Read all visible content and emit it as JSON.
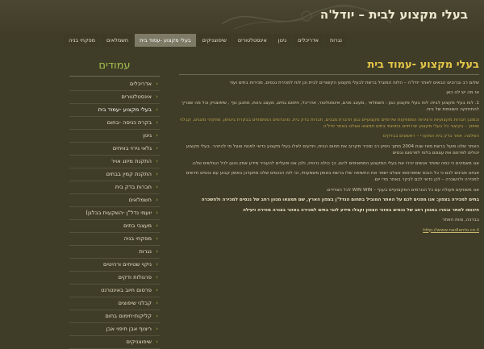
{
  "header": {
    "site_title": "בעלי מקצוע לבית – יודל'ה"
  },
  "nav": {
    "items": [
      {
        "label": "נגרות",
        "active": false
      },
      {
        "label": "אדריכלים",
        "active": false
      },
      {
        "label": "גינון",
        "active": false
      },
      {
        "label": "אינסטלטורים",
        "active": false
      },
      {
        "label": "שיפוצניקים",
        "active": false
      },
      {
        "label": "בעלי מקצוע -עמוד בית",
        "active": true
      },
      {
        "label": "חשמלאים",
        "active": false
      },
      {
        "label": "מפקחי בניה",
        "active": false
      }
    ]
  },
  "sidebar": {
    "title": "עמודים",
    "items": [
      {
        "label": "אדריכלים"
      },
      {
        "label": "אינסטלטורים"
      },
      {
        "label": "בעלי מקצוע -עמוד בית",
        "current": true
      },
      {
        "label": "בקרת כניסה -בחום"
      },
      {
        "label": "גינון"
      },
      {
        "label": "גלאי גירוי בוויחים"
      },
      {
        "label": "התקנת מיזוג אויר"
      },
      {
        "label": "התקנת קמין בבתים"
      },
      {
        "label": "חברות בדק בית"
      },
      {
        "label": "חשמלאים"
      },
      {
        "label": "יועמי נדל\"ן -השקעות בבלגן)"
      },
      {
        "label": "מעצבי בתים"
      },
      {
        "label": "מפקחי בניה"
      },
      {
        "label": "נגרות"
      },
      {
        "label": "ניקוי שטיחים ורהיטים"
      },
      {
        "label": "פרגולות ודקים"
      },
      {
        "label": "פרסום חיוב באינטרנט"
      },
      {
        "label": "קבלני שיפוצים"
      },
      {
        "label": "קליקות-חימום בחום"
      },
      {
        "label": "ריצוף אבן חיפוי אבן"
      },
      {
        "label": "שיפוצניקים"
      }
    ]
  },
  "content": {
    "title": "בעלי מקצוע -עמוד בית",
    "paragraphs": [
      {
        "text": "שלום רב וברוכים הבאים לאתר יודל'ה – הלוח המוביל ברשת לבעלי מקצוע הקשורים לבית וכן לוח למכירת נכסים, מכירות בתים ועוד",
        "style": "normal"
      },
      {
        "text": "אז מה יש לנו כאן",
        "style": "normal"
      },
      {
        "text": "1. לוח בעלי מקצוע לבית: לוח בעלי מקצוע כגון : חשמלאי , מעצב פנים, אינסטלטור, אדריכל, חימום בתים, מעצב גינות, מתכנן נוף , שיפוצניק וכל מה שצריך להתחזקה השוטפת של בית.",
        "style": "normal"
      },
      {
        "text": "וכמובן חברות מקצועיות ורציניות המספקות שירותים מקצועיים כגון הדברת מבנים, חברות בדק בית, מהנדסים המתמחים בבקרת ביטחון, מתקיני מזגנים, קבלני שיפוץ – בקיצור כל בעלי מקצוע יצירתיים בתחומי בתים תמצאו אצלנו באתר יודל'ה",
        "style": "accent"
      },
      {
        "text": "המלצה: אתר בדק בית המקורי – ראשונים בבדקים",
        "style": "accent"
      },
      {
        "text": "האתר שלנו פועל ברשת מאז שנת 2004 מתוך ניסיון רב ומכיר מקרוב את תחום הבית, ויודעים לאלו בעלי מקצוע כדאי לפנות ואצל מי להיזהר. בעלי מקצוע יכולים לפרסם את עצמם בלוח לפרסום נכסים",
        "style": "normal"
      },
      {
        "text": "אנו מאמינים כי כמה שיותר אנשים יכירו את בעלי המקצוע המתאימים להם, כך כולנו נרוויח, ולכן אנו פועלים להעביר מידע אמין והוגן לכל הגולשים שלנו.",
        "style": "normal"
      },
      {
        "text": "אנחנו מבינים לכם כי כל הנכס שתפרסמו אצלנו ישפר את החשיפה שלו ברשת באופן משמעותי, וכי לוח הנכסים שלנו מתעדכן באופן קבוע עם נכסים חדשים למכירה ולהשכרה – לכן כדאי לכם לבקר באתר מדי יום.",
        "style": "normal"
      },
      {
        "text": "אנו משווקים פעולה עם כל הגורמים המקצועיים בענף – WIN WIN לכל הצדדים.",
        "style": "normal"
      },
      {
        "text": "בתים למכירה בצפון: אנו מפנים לכם על האתר המוביל בתחום הנדל\"ן בצפון הארץ, שם תמצאו מגוון רחב של נכסים למכירה ולהשכרה",
        "style": "strong"
      },
      {
        "text": "היכנסו לאתר ובחרו במגוון רחב של נכסים באזור הצפון וקבלו מידע לגבי בתים למכירה באזור בצורה מהירה ויעילה",
        "style": "strong"
      },
      {
        "text": "בברכה, צוות האתר",
        "style": "normal"
      },
      {
        "text": "http://www.nadlanto.co.il",
        "style": "link"
      }
    ]
  },
  "colors": {
    "background": "#3f3c27",
    "accent_green": "#a6c24e",
    "title_gold": "#e6c84a",
    "nav_active": "#7d7a66"
  }
}
